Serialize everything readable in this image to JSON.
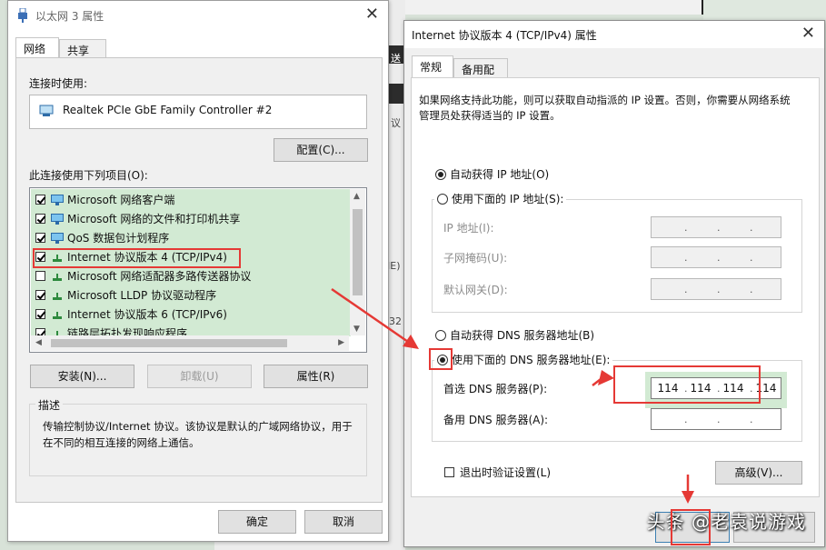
{
  "window1": {
    "title": "以太网 3 属性",
    "tabs": [
      "网络",
      "共享"
    ],
    "connect_using_label": "连接时使用:",
    "adapter_name": "Realtek PCIe GbE Family Controller #2",
    "configure_button": "配置(C)...",
    "items_label": "此连接使用下列项目(O):",
    "items": [
      {
        "label": "Microsoft 网络客户端",
        "checked": true
      },
      {
        "label": "Microsoft 网络的文件和打印机共享",
        "checked": true
      },
      {
        "label": "QoS 数据包计划程序",
        "checked": true
      },
      {
        "label": "Internet 协议版本 4 (TCP/IPv4)",
        "checked": true
      },
      {
        "label": "Microsoft 网络适配器多路传送器协议",
        "checked": false
      },
      {
        "label": "Microsoft LLDP 协议驱动程序",
        "checked": true
      },
      {
        "label": "Internet 协议版本 6 (TCP/IPv6)",
        "checked": true
      },
      {
        "label": "链路层拓扑发现响应程序",
        "checked": true
      }
    ],
    "install_button": "安装(N)...",
    "uninstall_button": "卸载(U)",
    "properties_button": "属性(R)",
    "description_title": "描述",
    "description_text": "传输控制协议/Internet 协议。该协议是默认的广域网络协议，用于在不同的相互连接的网络上通信。",
    "ok_button": "确定",
    "cancel_button": "取消"
  },
  "window2": {
    "title": "Internet 协议版本 4 (TCP/IPv4) 属性",
    "tabs": [
      "常规",
      "备用配置"
    ],
    "intro_text": "如果网络支持此功能，则可以获取自动指派的 IP 设置。否则，你需要从网络系统管理员处获得适当的 IP 设置。",
    "auto_ip_label": "自动获得 IP 地址(O)",
    "manual_ip_label": "使用下面的 IP 地址(S):",
    "ip_address_label": "IP 地址(I):",
    "subnet_label": "子网掩码(U):",
    "gateway_label": "默认网关(D):",
    "auto_dns_label": "自动获得 DNS 服务器地址(B)",
    "manual_dns_label": "使用下面的 DNS 服务器地址(E):",
    "preferred_dns_label": "首选 DNS 服务器(P):",
    "preferred_dns": [
      "114",
      "114",
      "114",
      "114"
    ],
    "alternate_dns_label": "备用 DNS 服务器(A):",
    "validate_label": "退出时验证设置(L)",
    "advanced_button": "高级(V)...",
    "watermark": "头条 @老袁说游戏"
  },
  "background": {
    "fragments": [
      "送",
      "议",
      "IE)",
      "32",
      "送"
    ]
  },
  "colors": {
    "highlight": "#e53935",
    "selection_green": "#d2ead3"
  }
}
